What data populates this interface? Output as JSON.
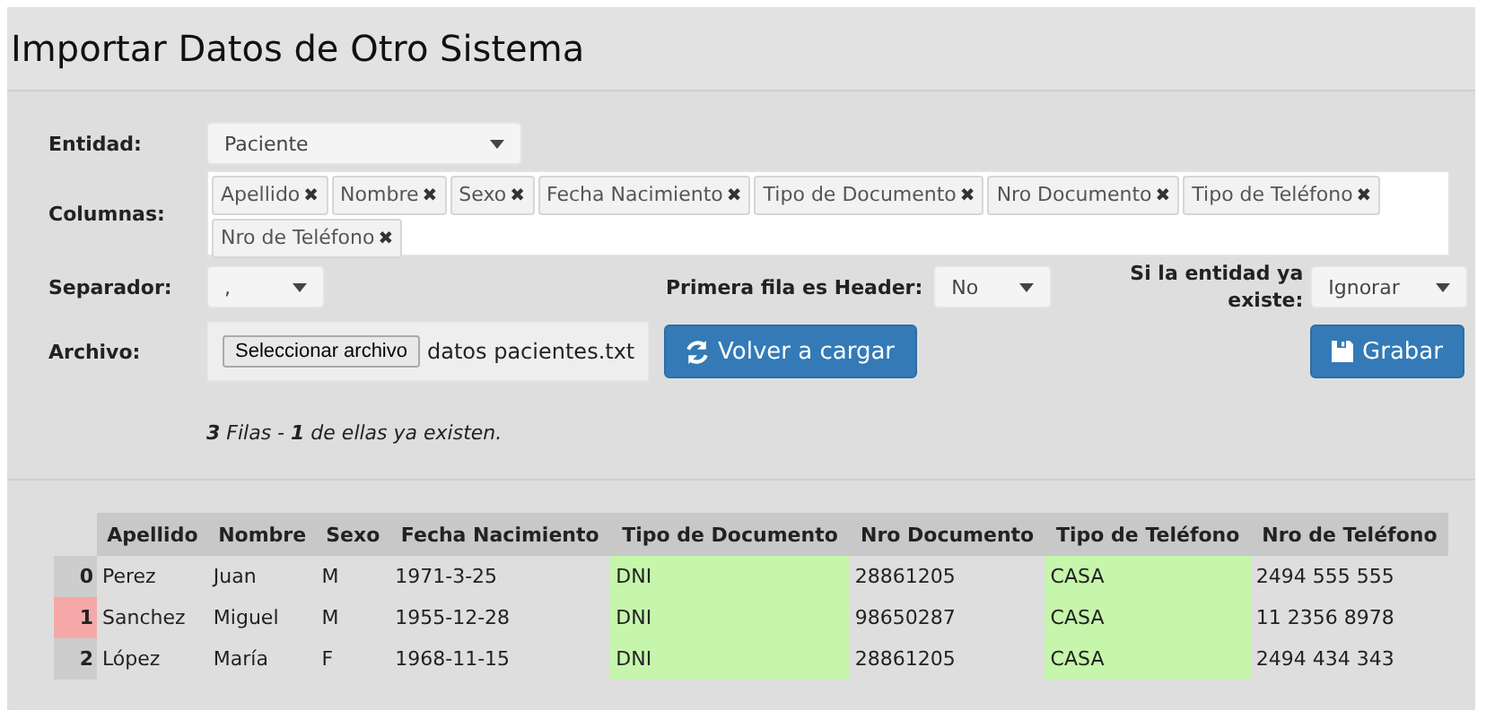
{
  "title": "Importar Datos de Otro Sistema",
  "entity": {
    "label": "Entidad:",
    "value": "Paciente"
  },
  "columns_field": {
    "label": "Columnas:",
    "tags": [
      "Apellido",
      "Nombre",
      "Sexo",
      "Fecha Nacimiento",
      "Tipo de Documento",
      "Nro Documento",
      "Tipo de Teléfono",
      "Nro de Teléfono"
    ],
    "remove_glyph": "✖"
  },
  "separator": {
    "label": "Separador:",
    "value": ","
  },
  "header_row": {
    "label": "Primera fila es Header:",
    "value": "No"
  },
  "if_exists": {
    "label": "Si la entidad ya existe:",
    "value": "Ignorar"
  },
  "file": {
    "label": "Archivo:",
    "button": "Seleccionar archivo",
    "filename": "datos pacientes.txt"
  },
  "reload_button": "Volver a cargar",
  "save_button": "Grabar",
  "summary": "**3** Filas - **1** de ellas ya existen.",
  "table": {
    "columns": [
      {
        "label": "Apellido",
        "highlighted": false
      },
      {
        "label": "Nombre",
        "highlighted": false
      },
      {
        "label": "Sexo",
        "highlighted": false
      },
      {
        "label": "Fecha Nacimiento",
        "highlighted": false
      },
      {
        "label": "Tipo de Documento",
        "highlighted": true
      },
      {
        "label": "Nro Documento",
        "highlighted": false
      },
      {
        "label": "Tipo de Teléfono",
        "highlighted": true
      },
      {
        "label": "Nro de Teléfono",
        "highlighted": false
      }
    ],
    "rows": [
      {
        "index": "0",
        "exists": false,
        "cells": [
          "Perez",
          "Juan",
          "M",
          "1971-3-25",
          "DNI",
          "28861205",
          "CASA",
          "2494 555 555"
        ]
      },
      {
        "index": "1",
        "exists": true,
        "cells": [
          "Sanchez",
          "Miguel",
          "M",
          "1955-12-28",
          "DNI",
          "98650287",
          "CASA",
          "11 2356 8978"
        ]
      },
      {
        "index": "2",
        "exists": false,
        "cells": [
          "López",
          "María",
          "F",
          "1968-11-15",
          "DNI",
          "28861205",
          "CASA",
          "2494 434 343"
        ]
      }
    ]
  }
}
